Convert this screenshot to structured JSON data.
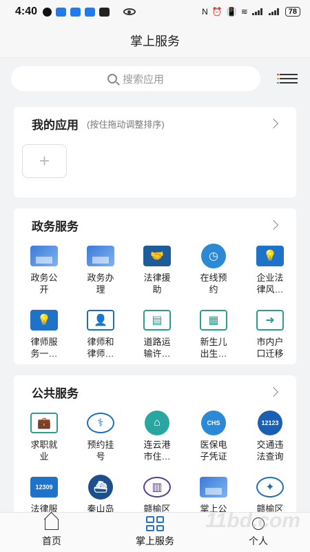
{
  "status": {
    "time": "4:40",
    "battery": "78"
  },
  "title": "掌上服务",
  "search": {
    "placeholder": "搜索应用"
  },
  "my_apps": {
    "title": "我的应用",
    "hint": "(按住拖动调整排序)",
    "add": "+"
  },
  "gov": {
    "title": "政务服务",
    "items": [
      {
        "label": "政务公开",
        "icon": "gov-open-icon"
      },
      {
        "label": "政务办理",
        "icon": "gov-handle-icon"
      },
      {
        "label": "法律援助",
        "icon": "handshake-icon"
      },
      {
        "label": "在线预约",
        "icon": "calendar-icon"
      },
      {
        "label": "企业法律风…",
        "icon": "bulb-icon"
      },
      {
        "label": "律师服务一…",
        "icon": "bulb-icon"
      },
      {
        "label": "律师和律师…",
        "icon": "lawyer-icon"
      },
      {
        "label": "道路运输许…",
        "icon": "road-license-icon"
      },
      {
        "label": "新生儿出生…",
        "icon": "newborn-icon"
      },
      {
        "label": "市内户口迁移",
        "icon": "folder-move-icon"
      }
    ]
  },
  "pub": {
    "title": "公共服务",
    "items": [
      {
        "label": "求职就业",
        "icon": "job-icon"
      },
      {
        "label": "预约挂号",
        "icon": "hospital-icon"
      },
      {
        "label": "连云港市住…",
        "icon": "housing-icon"
      },
      {
        "label": "医保电子凭证",
        "icon": "chs-icon",
        "text": "CHS"
      },
      {
        "label": "交通违法查询",
        "icon": "traffic-12123-icon",
        "text": "12123"
      },
      {
        "label": "法律服务",
        "icon": "law-12309-icon",
        "text": "12309"
      },
      {
        "label": "秦山岛购票",
        "icon": "boat-icon"
      },
      {
        "label": "赣榆区图书馆",
        "icon": "library-icon"
      },
      {
        "label": "掌上公交",
        "icon": "bus-icon"
      },
      {
        "label": "赣榆区人民…",
        "icon": "emblem-icon"
      }
    ]
  },
  "tabs": [
    {
      "label": "首页"
    },
    {
      "label": "掌上服务"
    },
    {
      "label": "个人"
    }
  ],
  "watermark": "11bd.com"
}
